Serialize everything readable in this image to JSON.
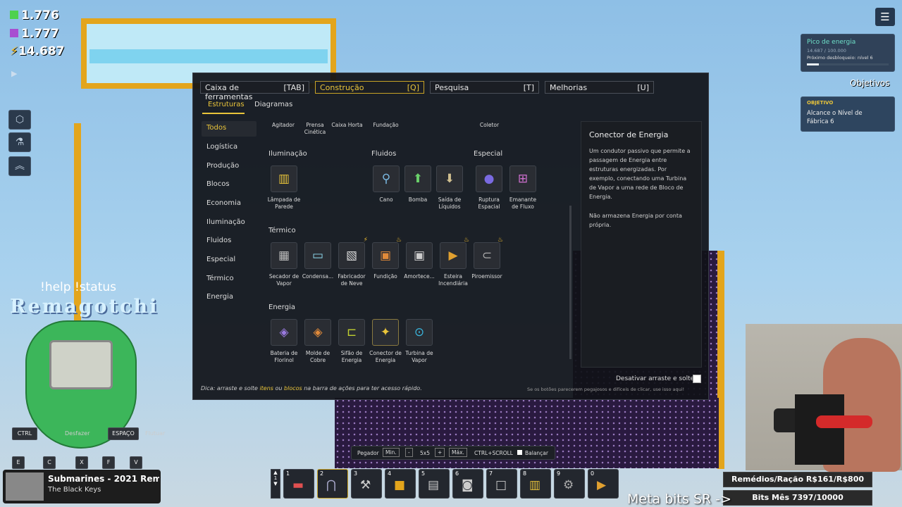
{
  "resources": {
    "green": "1.776",
    "purple": "1.777",
    "power": "14.687"
  },
  "overlay": {
    "tabs": [
      {
        "label": "Caixa de ferramentas",
        "key": "[TAB]"
      },
      {
        "label": "Construção",
        "key": "[Q]"
      },
      {
        "label": "Pesquisa",
        "key": "[T]"
      },
      {
        "label": "Melhorias",
        "key": "[U]"
      }
    ],
    "subtabs": [
      "Estruturas",
      "Diagramas"
    ],
    "categories": [
      "Todos",
      "Logística",
      "Produção",
      "Blocos",
      "Economia",
      "Iluminação",
      "Fluidos",
      "Especial",
      "Térmico",
      "Energia"
    ],
    "top_row": [
      "Agitador",
      "Prensa Cinética",
      "Caixa Horta",
      "Fundação",
      "Coletor"
    ],
    "sections": {
      "iluminacao": "Iluminação",
      "fluidos": "Fluidos",
      "especial": "Especial",
      "termico": "Térmico",
      "energia": "Energia"
    },
    "items": {
      "iluminacao": [
        "Lâmpada de Parede"
      ],
      "fluidos": [
        "Cano",
        "Bomba",
        "Saída de Líquidos"
      ],
      "especial": [
        "Ruptura Espacial",
        "Emanante de Fluxo"
      ],
      "termico": [
        "Secador de Vapor",
        "Condensa...",
        "Fabricador de Neve",
        "Fundição",
        "Amortece...",
        "Esteira Incendiária",
        "Piroemissor"
      ],
      "energia": [
        "Bateria de Florinol",
        "Molde de Cobre",
        "Sifão de Energia",
        "Conector de Energia",
        "Turbina de Vapor"
      ]
    },
    "detail": {
      "title": "Conector de Energia",
      "body": "Um condutor passivo que permite a passagem de Energia entre estruturas energizadas. Por exemplo, conectando uma Turbina de Vapor a uma rede de Bloco de Energia.",
      "note": "Não armazena Energia por conta própria."
    },
    "toggle_label": "Desativar arraste e solte",
    "hint_prefix": "Dica: arraste e solte ",
    "hint_items": "itens",
    "hint_or": " ou ",
    "hint_blocks": "blocos",
    "hint_suffix": " na barra de ações para ter acesso rápido.",
    "hint_right": "Se os botões parecerem pegajosos e difíceis de clicar, use isso aqui!"
  },
  "energy_panel": {
    "title": "Pico de energia",
    "value": "14.687 / 100.000",
    "next": "Próximo desbloqueio: nível 6",
    "progress": 0.14687
  },
  "objectives": {
    "label": "Objetivos",
    "tag": "OBJETIVO",
    "text": "Alcance o Nível de Fábrica 6"
  },
  "overlay_stream": {
    "help": "!help !status",
    "logo": "Remagotchi",
    "song": "Submarines - 2021 Remo",
    "artist": "The Black Keys",
    "remedios": "Remédios/Ração R$161/R$800",
    "bits": "Bits Mês 7397/10000",
    "meta": "Meta bits SR ->"
  },
  "controls": {
    "ctrl": "CTRL",
    "desfazer": "Desfazer",
    "espaco": "ESPAÇO",
    "flutuar": "Flutuar",
    "e": "E",
    "c": "C",
    "x": "X",
    "f": "F",
    "v": "V"
  },
  "toolbar": {
    "pegador": "Pegador",
    "min": "Min.",
    "minus": "-",
    "size": "5x5",
    "plus": "+",
    "max": "Máx.",
    "scroll": "CTRL+SCROLL",
    "balance": "Balançar"
  },
  "hotbar": [
    "1",
    "2",
    "3",
    "4",
    "5",
    "6",
    "7",
    "8",
    "9",
    "0"
  ],
  "colors": {
    "accent": "#e9c43a",
    "frame": "#e3a51c"
  }
}
